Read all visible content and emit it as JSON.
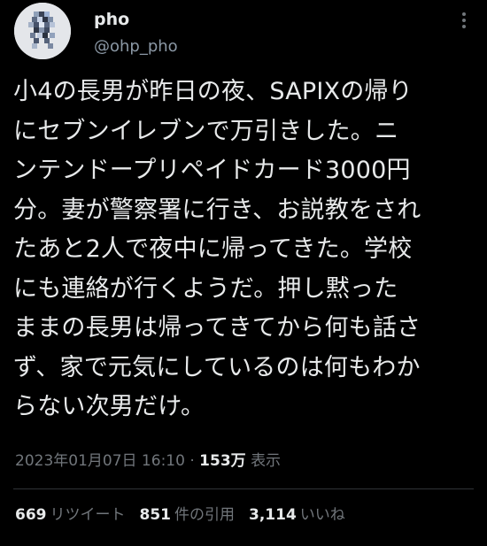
{
  "tweet": {
    "author": {
      "display_name": "pho",
      "handle": "@ohp_pho",
      "avatar_icon": "pixel-figure-avatar"
    },
    "more_icon": "more-vertical-icon",
    "text": "小4の長男が昨日の夜、SAPIXの帰り\nにセブンイレブンで万引きした。ニ\nンテンドープリペイドカード3000円\n分。妻が警察署に行き、お説教をされ\nたあと2人で夜中に帰ってきた。学校\nにも連絡が行くようだ。押し黙った\nままの長男は帰ってきてから何も話さ\nず、家で元気にしているのは何もわか\nらない次男だけ。",
    "timestamp": "2023年01月07日 16:10",
    "separator": "·",
    "views_count": "153万",
    "views_label": "表示"
  },
  "stats": {
    "retweets": {
      "count": "669",
      "label": "リツイート"
    },
    "quotes": {
      "count": "851",
      "label": "件の引用"
    },
    "likes": {
      "count": "3,114",
      "label": "いいね"
    }
  },
  "colors": {
    "background": "#000000",
    "primary_text": "#e7e9ea",
    "secondary_text": "#71767b",
    "divider": "#2f3336"
  }
}
